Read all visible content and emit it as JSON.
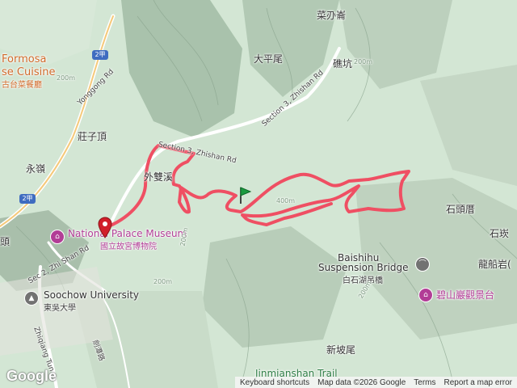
{
  "map": {
    "labels": {
      "caimutou": "菜刅崙",
      "dapingwei": "大平尾",
      "banpi": "礁坑",
      "formosa": "Formosa",
      "cuisine": "se Cuisine",
      "cuisine_zh": "古台菜餐廳",
      "route2": "2甲",
      "yonggong_rd": "Yonggong Rd",
      "zhuangziding": "莊子頂",
      "yongmou": "永嶺",
      "zhishan3a": "Section 3, Zhishan Rd",
      "zhishan3b": "Section 3, Zhishan Rd",
      "waishuangxi": "外雙溪",
      "national_palace": "National Palace Museum",
      "national_palace_zh": "國立故宮博物院",
      "tou": "頭",
      "sec2_zhishan": "Sec 2, Zhi Shan Rd",
      "soochow": "Soochow University",
      "soochow_zh": "東吳大學",
      "zhiqiang": "Zhiqiang Tun",
      "shitoupi": "石頭厝",
      "shicuo": "石崁",
      "longchuan": "龍船岩(",
      "baishihu": "Baishihu",
      "suspension": "Suspension Bridge",
      "baishihu_zh": "白石湖吊橋",
      "biyan": "碧山巖觀景台",
      "xinpowei": "新坡尾",
      "jinmian_trail": "Jinmianshan Trail",
      "jianan_rd": "劍潭路",
      "c200a": "200m",
      "c200b": "200m",
      "c200c": "200m",
      "c400": "400m",
      "c200d": "200m",
      "c200e": "200m"
    }
  },
  "footer": {
    "shortcuts": "Keyboard shortcuts",
    "mapdata": "Map data ©2026 Google",
    "terms": "Terms",
    "report": "Report a map error"
  },
  "google_logo": "Google",
  "colors": {
    "track": "#ef4f63",
    "terrain": "#cfe3d2",
    "ridge": "#8aa48e",
    "start": "#1a9a3f",
    "pin": "#d11f2a"
  }
}
